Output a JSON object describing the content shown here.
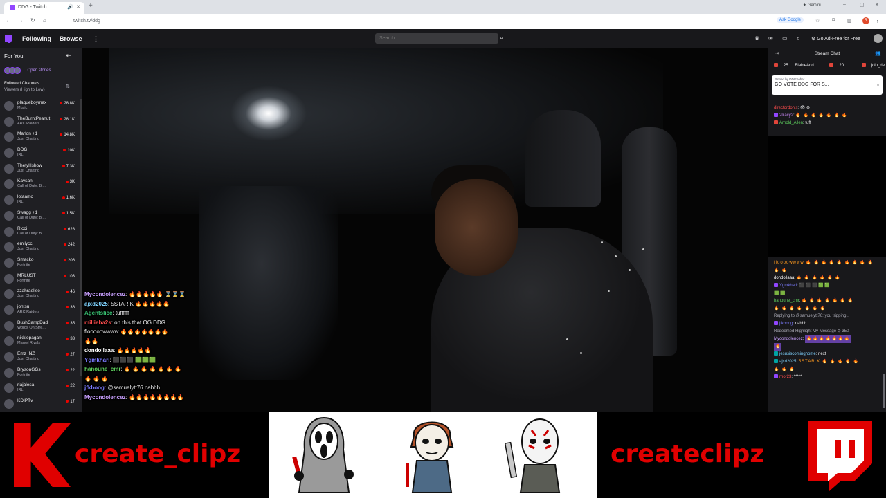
{
  "browser": {
    "tab_title": "DDG - Twitch",
    "url": "twitch.tv/ddg",
    "gemini_label": "Gemini",
    "ask_google_label": "Ask Google",
    "profile_initial": "R"
  },
  "twitch_nav": {
    "following": "Following",
    "browse": "Browse",
    "search_placeholder": "Search",
    "ad_free": "Go Ad-Free for Free"
  },
  "sidebar": {
    "for_you": "For You",
    "open_stories": "Open stories",
    "followed_channels": "Followed Channels",
    "sort_label": "Viewers (High to Low)",
    "channels": [
      {
        "name": "plaqueboymax",
        "game": "Music",
        "viewers": "28.8K"
      },
      {
        "name": "TheBurntPeanut",
        "game": "ARC Raiders",
        "viewers": "28.1K"
      },
      {
        "name": "Marlon +1",
        "game": "Just Chatting",
        "viewers": "14.8K"
      },
      {
        "name": "DDG",
        "game": "IRL",
        "viewers": "10K"
      },
      {
        "name": "Thetylilshow",
        "game": "Just Chatting",
        "viewers": "7.3K"
      },
      {
        "name": "Kaysan",
        "game": "Call of Duty: Bl...",
        "viewers": "3K"
      },
      {
        "name": "lotaamc",
        "game": "IRL",
        "viewers": "1.6K"
      },
      {
        "name": "Swagg +1",
        "game": "Call of Duty: Bl...",
        "viewers": "1.5K"
      },
      {
        "name": "Ricci",
        "game": "Call of Duty: Bl...",
        "viewers": "628"
      },
      {
        "name": "emilycc",
        "game": "Just Chatting",
        "viewers": "242"
      },
      {
        "name": "Smacko",
        "game": "Fortnite",
        "viewers": "206"
      },
      {
        "name": "MRLUST",
        "game": "Fortnite",
        "viewers": "103"
      },
      {
        "name": "zzahraelise",
        "game": "Just Chatting",
        "viewers": "46"
      },
      {
        "name": "johtsu",
        "game": "ARC Raiders",
        "viewers": "36"
      },
      {
        "name": "BushCampDad",
        "game": "Words On Stre...",
        "viewers": "35"
      },
      {
        "name": "nikkiepagan",
        "game": "Marvel Rivals",
        "viewers": "33"
      },
      {
        "name": "Emz_NZ",
        "game": "Just Chatting",
        "viewers": "27"
      },
      {
        "name": "BrysonGGs",
        "game": "Fortnite",
        "viewers": "22"
      },
      {
        "name": "riajalesa",
        "game": "IRL",
        "viewers": "22"
      },
      {
        "name": "KDIPTv",
        "game": "",
        "viewers": "17"
      }
    ]
  },
  "video_chat_overlay": [
    {
      "user": "Mycondolencez",
      "color": "#c9a0ff",
      "text": "🔥🔥🔥🔥🔥 ⌛⌛⌛"
    },
    {
      "user": "ajxd2025",
      "color": "#7fd3ff",
      "text": "5STAR K 🔥🔥🔥🔥🔥"
    },
    {
      "user": "Agentslicc",
      "color": "#38c172",
      "text": "tuffffff"
    },
    {
      "user": "millieba2s",
      "color": "#ff4d4d",
      "text": "oh this that OG DDG"
    },
    {
      "user": "",
      "color": "#ffffff",
      "text": "flooooowwww 🔥🔥🔥🔥🔥🔥🔥"
    },
    {
      "user": "",
      "color": "#ffffff",
      "text": "🔥🔥"
    },
    {
      "user": "dondollaaa",
      "color": "#ffffff",
      "text": "🔥🔥🔥🔥🔥"
    },
    {
      "user": "Ygmkhari",
      "color": "#7c7cff",
      "text": "⬛⬛⬛ 🟩🟩🟩"
    },
    {
      "user": "hanoune_cmr",
      "color": "#5fd35f",
      "text": "🔥 🔥 🔥 🔥 🔥 🔥 🔥"
    },
    {
      "user": "",
      "color": "#ffffff",
      "text": "🔥 🔥 🔥"
    },
    {
      "user": "jfkboog",
      "color": "#7c7cff",
      "text": "@samuelytt76 nahhh"
    },
    {
      "user": "Mycondolencez",
      "color": "#c9a0ff",
      "text": "🔥🔥🔥🔥🔥🔥🔥🔥"
    }
  ],
  "chat": {
    "title": "Stream Chat",
    "gifts": [
      {
        "count": "25",
        "name": "BlaineAnd..."
      },
      {
        "count": "20",
        "name": ""
      },
      {
        "count": "",
        "name": "join_de"
      }
    ],
    "pinned_by": "Pinned by DDGSober",
    "pinned_text": "GO VOTE DDG FOR S...",
    "top_lines": [
      {
        "user": "directordonis",
        "color": "#ff4d4d",
        "text": "👁 ⊕"
      },
      {
        "user": "2lilacy2",
        "color": "#d28cff",
        "text": "🔥 🔥 🔥 🔥 🔥 🔥 🔥"
      },
      {
        "user": "Arnold_Allen",
        "color": "#5fd35f",
        "text": "tuff"
      }
    ],
    "lines": [
      {
        "user": "",
        "color": "#ffffff",
        "text": "floooowwww 🔥 🔥 🔥 🔥 🔥 🔥 🔥 🔥 🔥"
      },
      {
        "user": "",
        "color": "#ffffff",
        "text": "🔥 🔥"
      },
      {
        "user": "dondollaaa",
        "color": "#ffffff",
        "text": "🔥 🔥 🔥 🔥 🔥 🔥"
      },
      {
        "user": "Ygmkhari",
        "color": "#7c7cff",
        "text": "⬛ ⬛ ⬛ 🟩 🟩"
      },
      {
        "user": "",
        "color": "#ffffff",
        "text": "🟩 🟩"
      },
      {
        "user": "hanoune_cmr",
        "color": "#5fd35f",
        "text": "🔥 🔥 🔥 🔥 🔥 🔥 🔥"
      },
      {
        "user": "",
        "color": "#ffffff",
        "text": "🔥 🔥 🔥 🔥 🔥 🔥 🔥"
      },
      {
        "user": "",
        "color": "#adadb8",
        "text": "Replying to @samuelytt76: you tripping..."
      },
      {
        "user": "jfkboog",
        "color": "#7c7cff",
        "text": "nahhh"
      },
      {
        "user": "",
        "color": "#adadb8",
        "text": "Redeemed Highlight My Message ⊙ 350"
      },
      {
        "user": "Mycondolencez",
        "color": "#c9a0ff",
        "text": "🔥 🔥 🔥 🔥 🔥 🔥 🔥"
      },
      {
        "user": "",
        "color": "#ffffff",
        "text": "🔥"
      },
      {
        "user": "jesusiscominghome",
        "color": "#7fd3ff",
        "text": "next"
      },
      {
        "user": "ajxd2025",
        "color": "#7fd3ff",
        "text": "5STAR K 🔥 🔥 🔥 🔥 🔥"
      },
      {
        "user": "",
        "color": "#ffffff",
        "text": "🔥 🔥 🔥"
      },
      {
        "user": "rnor23",
        "color": "#ff4d4d",
        "text": "*****"
      }
    ]
  },
  "branding": {
    "left_text": "create_clipz",
    "right_text": "createclipz",
    "accent": "#e00000"
  }
}
